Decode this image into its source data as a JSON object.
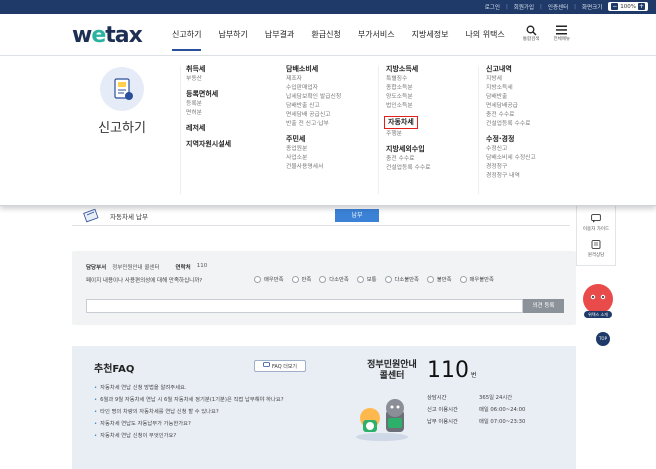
{
  "topbar": {
    "links": [
      "로그인",
      "회원가입",
      "인증센터",
      "화면크기"
    ],
    "zoom": "100%",
    "zoom_minus": "−",
    "zoom_plus": "+"
  },
  "header": {
    "logo_prefix": "w",
    "logo_e": "e",
    "logo_suffix": "tax",
    "nav": [
      "신고하기",
      "납부하기",
      "납부결과",
      "환급신청",
      "부가서비스",
      "지방세정보",
      "나의 위택스"
    ],
    "icons": [
      {
        "icon": "search-icon",
        "label": "통합검색"
      },
      {
        "icon": "menu-icon",
        "label": "전체메뉴"
      }
    ]
  },
  "mega": {
    "side_title": "신고하기",
    "columns": [
      {
        "groups": [
          {
            "head": "취득세",
            "items": [
              "부동산"
            ]
          },
          {
            "head": "등록면허세",
            "items": [
              "등록분",
              "면허분"
            ]
          },
          {
            "head": "레저세",
            "items": []
          },
          {
            "head": "지역자원시설세",
            "items": []
          }
        ]
      },
      {
        "groups": [
          {
            "head": "담배소비세",
            "items": [
              "제조자",
              "수입판매업자",
              "납세담보확인 발급신청",
              "담배반출 신고",
              "면세담배 공급신고",
              "반출 전 신고·납부"
            ]
          },
          {
            "head": "주민세",
            "items": [
              "종업원분",
              "사업소분",
              "건물사용명세서"
            ]
          }
        ]
      },
      {
        "groups": [
          {
            "head": "지방소득세",
            "items": [
              "특별징수",
              "종합소득분",
              "양도소득분",
              "법인소득분"
            ]
          },
          {
            "head": "자동차세",
            "items": [
              "주행분"
            ],
            "highlight": true
          },
          {
            "head": "지방세외수입",
            "items": [
              "충전 수수료",
              "건설업등록 수수료"
            ]
          }
        ]
      },
      {
        "groups": [
          {
            "head": "신고내역",
            "items": [
              "지방세",
              "지방소득세",
              "담배반출",
              "면세담배공급",
              "충전 수수료",
              "건설업등록 수수료"
            ]
          },
          {
            "head": "수정·경정",
            "items": [
              "수정신고",
              "담배소비세 수정신고",
              "경정청구",
              "경정청구 내역"
            ]
          }
        ]
      }
    ]
  },
  "content": {
    "tax_row_label": "자동차세 납부",
    "tax_row_button": "납부",
    "survey": {
      "dept_label": "담당부서",
      "dept_value": "정부민원안내 콜센터",
      "phone_label": "연락처",
      "phone_value": "110",
      "question": "페이지 내용이나 사용편의성에 대해 만족하십니까?",
      "options": [
        "매우만족",
        "만족",
        "다소만족",
        "보통",
        "다소불만족",
        "불만족",
        "매우불만족"
      ],
      "submit": "의견 등록"
    },
    "faq": {
      "title": "추천FAQ",
      "more": "FAQ 더보기",
      "items": [
        "자동차세 연납 신청 방법을 알려주세요.",
        "6월과 9월 자동차세 연납 시 6월 자동차세 정기분(1기분)은 직접 납부해야 하나요?",
        "타인 명의 차량의 자동차세를 연납 신청 할 수 있나요?",
        "자동차세 연납도 자동납부가 가능한가요?",
        "자동차세 연납 신청이 무엇인가요?"
      ]
    },
    "callcenter": {
      "title": "정부민원안내 콜센터",
      "number": "110",
      "number_unit": "번",
      "hours": [
        {
          "k": "상담시간",
          "v": "365일 24시간"
        },
        {
          "k": "신고 이용시간",
          "v": "매일 06:00~24:00"
        },
        {
          "k": "납부 이용시간",
          "v": "매일 07:00~23:30"
        }
      ]
    }
  },
  "quick": {
    "items": [
      {
        "icon": "chat-icon",
        "label": "이용자 가이드"
      },
      {
        "icon": "doc-icon",
        "label": "원격상담"
      }
    ],
    "character_label": "위택스 소개",
    "top": "TOP"
  }
}
